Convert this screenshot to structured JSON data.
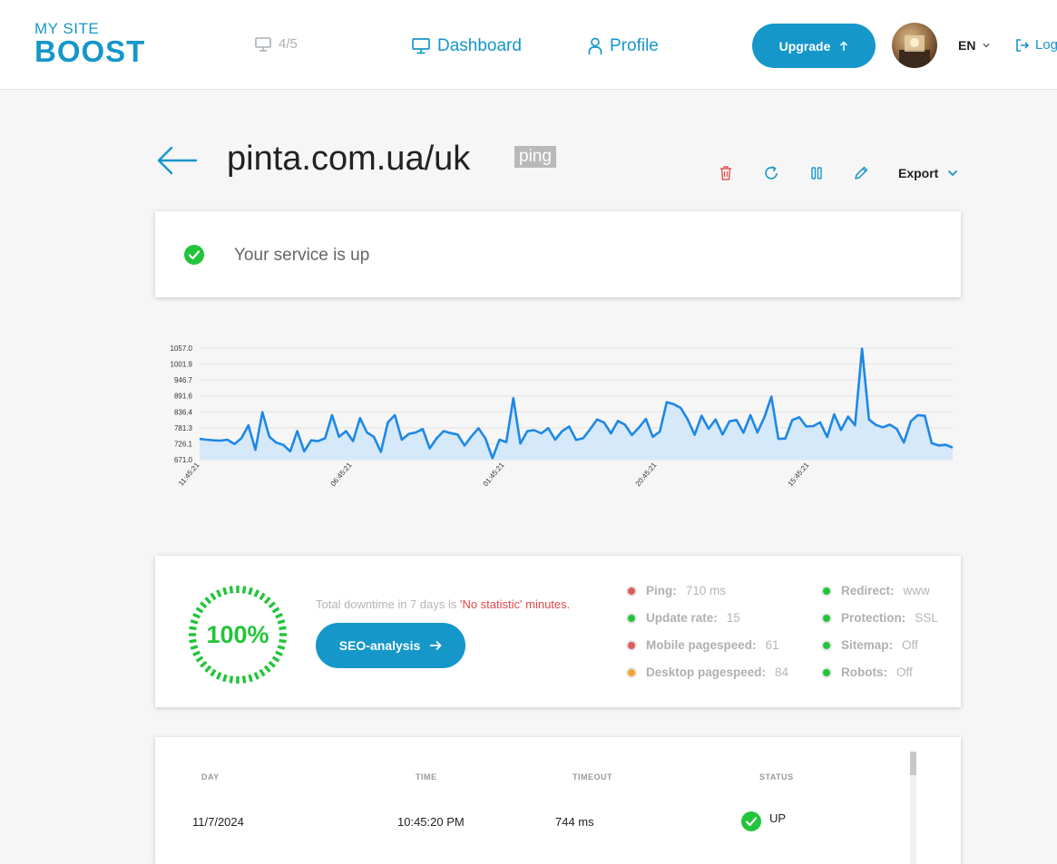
{
  "header": {
    "logo_line1": "MY SITE",
    "logo_line2": "BOOST",
    "sites_counter": "4/5",
    "nav": [
      {
        "label": "Dashboard",
        "icon": "monitor-icon"
      },
      {
        "label": "Profile",
        "icon": "user-icon"
      }
    ],
    "upgrade_label": "Upgrade",
    "language": "EN",
    "logout_label": "Log out"
  },
  "page": {
    "site_title": "pinta.com.ua/uk",
    "check_type": "ping",
    "export_label": "Export",
    "actions": [
      "delete-icon",
      "refresh-icon",
      "pause-icon",
      "edit-icon"
    ]
  },
  "status": {
    "text": "Your service is up"
  },
  "chart_data": {
    "type": "area",
    "yticks": [
      "1057.0",
      "1001.9",
      "946.7",
      "891.6",
      "836.4",
      "781.3",
      "726.1",
      "671.0"
    ],
    "ylim": [
      671.0,
      1057.0
    ],
    "xticks": [
      "11:45:21",
      "06:45:21",
      "01:45:21",
      "20:45:21",
      "15:45:21"
    ],
    "values": [
      743,
      740,
      738,
      737,
      740,
      725,
      745,
      790,
      705,
      835,
      750,
      730,
      722,
      700,
      770,
      700,
      738,
      735,
      745,
      825,
      750,
      770,
      735,
      815,
      765,
      750,
      698,
      800,
      825,
      740,
      760,
      765,
      777,
      710,
      745,
      770,
      763,
      758,
      720,
      752,
      780,
      744,
      676,
      740,
      732,
      884,
      727,
      770,
      773,
      762,
      780,
      740,
      770,
      786,
      739,
      745,
      776,
      810,
      800,
      762,
      805,
      792,
      756,
      782,
      812,
      750,
      768,
      870,
      863,
      850,
      810,
      757,
      823,
      778,
      810,
      758,
      804,
      808,
      764,
      825,
      765,
      818,
      889,
      743,
      744,
      808,
      818,
      786,
      787,
      800,
      749,
      828,
      774,
      820,
      790,
      1055,
      810,
      791,
      783,
      792,
      777,
      730,
      804,
      825,
      823,
      728,
      720,
      722,
      713
    ]
  },
  "stats": {
    "uptime": "100%",
    "downtime_prefix": "Total downtime in 7 days is ",
    "downtime_value": "'No statistic'",
    "downtime_suffix": " minutes.",
    "seo_button": "SEO-analysis",
    "metrics_left": [
      {
        "label": "Ping:",
        "value": "710 ms",
        "color": "#e05a5a"
      },
      {
        "label": "Update rate:",
        "value": "15",
        "color": "#22c43a"
      },
      {
        "label": "Mobile pagespeed:",
        "value": "61",
        "color": "#e05a5a"
      },
      {
        "label": "Desktop pagespeed:",
        "value": "84",
        "color": "#f3a531"
      }
    ],
    "metrics_right": [
      {
        "label": "Redirect:",
        "value": "www",
        "color": "#22c43a"
      },
      {
        "label": "Protection:",
        "value": "SSL",
        "color": "#22c43a"
      },
      {
        "label": "Sitemap:",
        "value": "Off",
        "color": "#22c43a"
      },
      {
        "label": "Robots:",
        "value": "Off",
        "color": "#22c43a"
      }
    ]
  },
  "log_table": {
    "headers": [
      "DAY",
      "TIME",
      "TIMEOUT",
      "STATUS"
    ],
    "rows": [
      {
        "day": "11/7/2024",
        "time": "10:45:20 PM",
        "timeout": "744 ms",
        "status": "UP"
      }
    ]
  },
  "colors": {
    "accent": "#1597c9",
    "ok": "#22c43a",
    "error": "#e05a5a",
    "warning": "#f3a531",
    "chart_line": "#1e88e5",
    "chart_fill": "#cfe6fa"
  }
}
